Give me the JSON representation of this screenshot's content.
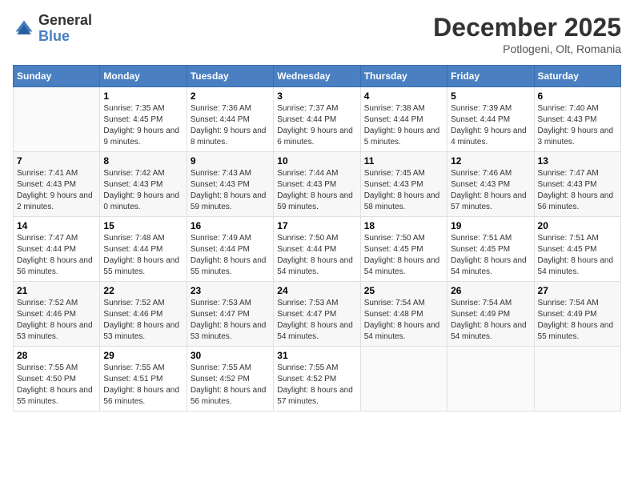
{
  "header": {
    "logo_general": "General",
    "logo_blue": "Blue",
    "month": "December 2025",
    "location": "Potlogeni, Olt, Romania"
  },
  "weekdays": [
    "Sunday",
    "Monday",
    "Tuesday",
    "Wednesday",
    "Thursday",
    "Friday",
    "Saturday"
  ],
  "weeks": [
    [
      {
        "day": "",
        "sunrise": "",
        "sunset": "",
        "daylight": ""
      },
      {
        "day": "1",
        "sunrise": "Sunrise: 7:35 AM",
        "sunset": "Sunset: 4:45 PM",
        "daylight": "Daylight: 9 hours and 9 minutes."
      },
      {
        "day": "2",
        "sunrise": "Sunrise: 7:36 AM",
        "sunset": "Sunset: 4:44 PM",
        "daylight": "Daylight: 9 hours and 8 minutes."
      },
      {
        "day": "3",
        "sunrise": "Sunrise: 7:37 AM",
        "sunset": "Sunset: 4:44 PM",
        "daylight": "Daylight: 9 hours and 6 minutes."
      },
      {
        "day": "4",
        "sunrise": "Sunrise: 7:38 AM",
        "sunset": "Sunset: 4:44 PM",
        "daylight": "Daylight: 9 hours and 5 minutes."
      },
      {
        "day": "5",
        "sunrise": "Sunrise: 7:39 AM",
        "sunset": "Sunset: 4:44 PM",
        "daylight": "Daylight: 9 hours and 4 minutes."
      },
      {
        "day": "6",
        "sunrise": "Sunrise: 7:40 AM",
        "sunset": "Sunset: 4:43 PM",
        "daylight": "Daylight: 9 hours and 3 minutes."
      }
    ],
    [
      {
        "day": "7",
        "sunrise": "Sunrise: 7:41 AM",
        "sunset": "Sunset: 4:43 PM",
        "daylight": "Daylight: 9 hours and 2 minutes."
      },
      {
        "day": "8",
        "sunrise": "Sunrise: 7:42 AM",
        "sunset": "Sunset: 4:43 PM",
        "daylight": "Daylight: 9 hours and 0 minutes."
      },
      {
        "day": "9",
        "sunrise": "Sunrise: 7:43 AM",
        "sunset": "Sunset: 4:43 PM",
        "daylight": "Daylight: 8 hours and 59 minutes."
      },
      {
        "day": "10",
        "sunrise": "Sunrise: 7:44 AM",
        "sunset": "Sunset: 4:43 PM",
        "daylight": "Daylight: 8 hours and 59 minutes."
      },
      {
        "day": "11",
        "sunrise": "Sunrise: 7:45 AM",
        "sunset": "Sunset: 4:43 PM",
        "daylight": "Daylight: 8 hours and 58 minutes."
      },
      {
        "day": "12",
        "sunrise": "Sunrise: 7:46 AM",
        "sunset": "Sunset: 4:43 PM",
        "daylight": "Daylight: 8 hours and 57 minutes."
      },
      {
        "day": "13",
        "sunrise": "Sunrise: 7:47 AM",
        "sunset": "Sunset: 4:43 PM",
        "daylight": "Daylight: 8 hours and 56 minutes."
      }
    ],
    [
      {
        "day": "14",
        "sunrise": "Sunrise: 7:47 AM",
        "sunset": "Sunset: 4:44 PM",
        "daylight": "Daylight: 8 hours and 56 minutes."
      },
      {
        "day": "15",
        "sunrise": "Sunrise: 7:48 AM",
        "sunset": "Sunset: 4:44 PM",
        "daylight": "Daylight: 8 hours and 55 minutes."
      },
      {
        "day": "16",
        "sunrise": "Sunrise: 7:49 AM",
        "sunset": "Sunset: 4:44 PM",
        "daylight": "Daylight: 8 hours and 55 minutes."
      },
      {
        "day": "17",
        "sunrise": "Sunrise: 7:50 AM",
        "sunset": "Sunset: 4:44 PM",
        "daylight": "Daylight: 8 hours and 54 minutes."
      },
      {
        "day": "18",
        "sunrise": "Sunrise: 7:50 AM",
        "sunset": "Sunset: 4:45 PM",
        "daylight": "Daylight: 8 hours and 54 minutes."
      },
      {
        "day": "19",
        "sunrise": "Sunrise: 7:51 AM",
        "sunset": "Sunset: 4:45 PM",
        "daylight": "Daylight: 8 hours and 54 minutes."
      },
      {
        "day": "20",
        "sunrise": "Sunrise: 7:51 AM",
        "sunset": "Sunset: 4:45 PM",
        "daylight": "Daylight: 8 hours and 54 minutes."
      }
    ],
    [
      {
        "day": "21",
        "sunrise": "Sunrise: 7:52 AM",
        "sunset": "Sunset: 4:46 PM",
        "daylight": "Daylight: 8 hours and 53 minutes."
      },
      {
        "day": "22",
        "sunrise": "Sunrise: 7:52 AM",
        "sunset": "Sunset: 4:46 PM",
        "daylight": "Daylight: 8 hours and 53 minutes."
      },
      {
        "day": "23",
        "sunrise": "Sunrise: 7:53 AM",
        "sunset": "Sunset: 4:47 PM",
        "daylight": "Daylight: 8 hours and 53 minutes."
      },
      {
        "day": "24",
        "sunrise": "Sunrise: 7:53 AM",
        "sunset": "Sunset: 4:47 PM",
        "daylight": "Daylight: 8 hours and 54 minutes."
      },
      {
        "day": "25",
        "sunrise": "Sunrise: 7:54 AM",
        "sunset": "Sunset: 4:48 PM",
        "daylight": "Daylight: 8 hours and 54 minutes."
      },
      {
        "day": "26",
        "sunrise": "Sunrise: 7:54 AM",
        "sunset": "Sunset: 4:49 PM",
        "daylight": "Daylight: 8 hours and 54 minutes."
      },
      {
        "day": "27",
        "sunrise": "Sunrise: 7:54 AM",
        "sunset": "Sunset: 4:49 PM",
        "daylight": "Daylight: 8 hours and 55 minutes."
      }
    ],
    [
      {
        "day": "28",
        "sunrise": "Sunrise: 7:55 AM",
        "sunset": "Sunset: 4:50 PM",
        "daylight": "Daylight: 8 hours and 55 minutes."
      },
      {
        "day": "29",
        "sunrise": "Sunrise: 7:55 AM",
        "sunset": "Sunset: 4:51 PM",
        "daylight": "Daylight: 8 hours and 56 minutes."
      },
      {
        "day": "30",
        "sunrise": "Sunrise: 7:55 AM",
        "sunset": "Sunset: 4:52 PM",
        "daylight": "Daylight: 8 hours and 56 minutes."
      },
      {
        "day": "31",
        "sunrise": "Sunrise: 7:55 AM",
        "sunset": "Sunset: 4:52 PM",
        "daylight": "Daylight: 8 hours and 57 minutes."
      },
      {
        "day": "",
        "sunrise": "",
        "sunset": "",
        "daylight": ""
      },
      {
        "day": "",
        "sunrise": "",
        "sunset": "",
        "daylight": ""
      },
      {
        "day": "",
        "sunrise": "",
        "sunset": "",
        "daylight": ""
      }
    ]
  ]
}
